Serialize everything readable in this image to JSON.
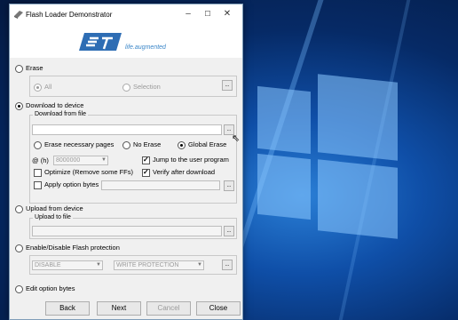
{
  "window": {
    "title": "Flash Loader Demonstrator"
  },
  "logo": {
    "tagline": "life.augmented",
    "brand_color": "#3a86c8"
  },
  "erase": {
    "label": "Erase",
    "all_label": "All",
    "selection_label": "Selection"
  },
  "download": {
    "label": "Download to device",
    "group_title": "Download from file",
    "file_value": "",
    "erase_necessary_label": "Erase necessary pages",
    "no_erase_label": "No Erase",
    "global_erase_label": "Global Erase",
    "address_label": "@ (h)",
    "address_value": "8000000",
    "jump_label": "Jump to the user program",
    "optimize_label": "Optimize (Remove some FFs)",
    "verify_label": "Verify after download",
    "apply_option_label": "Apply option bytes"
  },
  "upload": {
    "label": "Upload from device",
    "group_title": "Upload to file"
  },
  "protection": {
    "label": "Enable/Disable Flash protection",
    "state_value": "DISABLE",
    "type_value": "WRITE PROTECTION"
  },
  "option_bytes": {
    "label": "Edit option bytes"
  },
  "buttons": {
    "back": "Back",
    "next": "Next",
    "cancel": "Cancel",
    "close": "Close"
  },
  "ellipsis": "..."
}
